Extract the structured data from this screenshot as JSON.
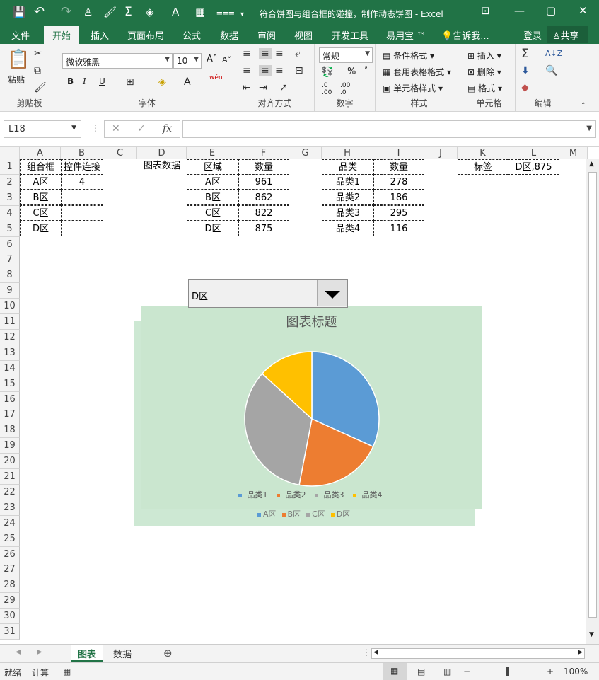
{
  "window": {
    "title": "符合饼图与组合框的碰撞，制作动态饼图 - Excel",
    "min": "—",
    "restore": "▢",
    "close": "✕",
    "ribbon_opts": "⊡"
  },
  "quick_access": {
    "save": "💾",
    "undo": "↶",
    "redo": "↷",
    "user": "♙",
    "brush": "🖌",
    "sum": "Σ",
    "fill": "◈",
    "fontcolor": "A",
    "picture": "▦",
    "more": "⩶"
  },
  "tabs": [
    "文件",
    "开始",
    "插入",
    "页面布局",
    "公式",
    "数据",
    "审阅",
    "视图",
    "开发工具",
    "易用宝 ™",
    "告诉我..."
  ],
  "active_tab": "开始",
  "login": "登录",
  "share": "共享",
  "ribbon": {
    "clipboard": {
      "label": "剪贴板",
      "paste": "粘贴"
    },
    "font": {
      "label": "字体",
      "name": "微软雅黑",
      "size": "10",
      "bold": "B",
      "italic": "I",
      "underline": "U",
      "grow": "A˄",
      "shrink": "A˅",
      "wen": "wén"
    },
    "align": {
      "label": "对齐方式"
    },
    "number": {
      "label": "数字",
      "format": "常规",
      "percent": "%",
      "comma": "’"
    },
    "styles": {
      "label": "样式",
      "conditional": "条件格式",
      "table": "套用表格格式",
      "cell": "单元格样式"
    },
    "cells": {
      "label": "单元格",
      "insert": "插入",
      "delete": "删除",
      "format": "格式"
    },
    "editing": {
      "label": "编辑"
    }
  },
  "formula_bar": {
    "name_box": "L18",
    "cancel": "✕",
    "enter": "✓",
    "fx": "fx",
    "formula": ""
  },
  "columns": [
    "A",
    "B",
    "C",
    "D",
    "E",
    "F",
    "G",
    "H",
    "I",
    "J",
    "K",
    "L",
    "M"
  ],
  "rows": [
    "1",
    "2",
    "3",
    "4",
    "5",
    "6",
    "7",
    "8",
    "9",
    "10",
    "11",
    "12",
    "13",
    "14",
    "15",
    "16",
    "17",
    "18",
    "19",
    "20",
    "21",
    "22",
    "23",
    "24",
    "25",
    "26",
    "27",
    "28",
    "29",
    "30",
    "31"
  ],
  "table1": {
    "h1": "组合框",
    "h2": "控件连接",
    "r1": "A区",
    "r1v": "4",
    "r2": "B区",
    "r3": "C区",
    "r4": "D区"
  },
  "label_chart_data": "图表数据",
  "table2": {
    "h1": "区域",
    "h2": "数量",
    "rows": [
      [
        "A区",
        "961"
      ],
      [
        "B区",
        "862"
      ],
      [
        "C区",
        "822"
      ],
      [
        "D区",
        "875"
      ]
    ]
  },
  "table3": {
    "h1": "品类",
    "h2": "数量",
    "rows": [
      [
        "品类1",
        "278"
      ],
      [
        "品类2",
        "186"
      ],
      [
        "品类3",
        "295"
      ],
      [
        "品类4",
        "116"
      ]
    ]
  },
  "table4": {
    "h1": "标签",
    "h2": "D区,875"
  },
  "combo_box": {
    "value": "D区"
  },
  "chart_data": {
    "type": "pie",
    "title": "图表标题",
    "categories": [
      "品类1",
      "品类2",
      "品类3",
      "品类4"
    ],
    "values": [
      278,
      186,
      295,
      116
    ],
    "colors": [
      "#5b9bd5",
      "#ed7d31",
      "#a5a5a5",
      "#ffc000"
    ],
    "legend": "bottom"
  },
  "back_chart_legend": [
    "A区",
    "B区",
    "C区",
    "D区"
  ],
  "sheets": [
    "图表",
    "数据"
  ],
  "active_sheet": "图表",
  "add_sheet": "⊕",
  "status": {
    "ready": "就绪",
    "calc": "计算",
    "zoom": "100%"
  }
}
